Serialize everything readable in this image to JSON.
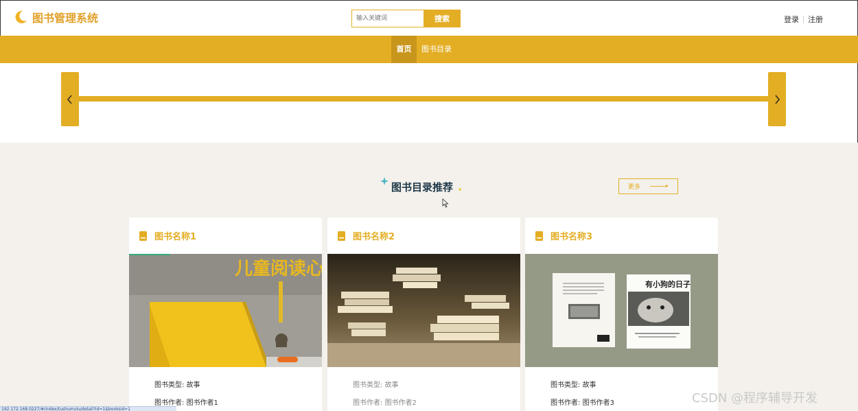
{
  "header": {
    "logo_text": "图书管理系统",
    "search_placeholder": "输入关键词",
    "search_button": "搜索",
    "login": "登录",
    "register": "注册"
  },
  "nav": {
    "items": [
      {
        "label": "首页",
        "active": true
      },
      {
        "label": "图书目录",
        "active": false
      }
    ]
  },
  "section": {
    "title": "图书目录推荐",
    "more_label": "更多"
  },
  "cards": [
    {
      "title": "图书名称1",
      "type_label": "图书类型",
      "type_value": "故事",
      "author_label": "图书作者",
      "author_value": "图书作者1",
      "cover_text": "儿童阅读心理"
    },
    {
      "title": "图书名称2",
      "type_label": "图书类型",
      "type_value": "故事",
      "author_label": "图书作者",
      "author_value": "图书作者2"
    },
    {
      "title": "图书名称3",
      "type_label": "图书类型",
      "type_value": "故事",
      "author_label": "图书作者",
      "author_value": "图书作者3",
      "cover_text": "有小狗的日子"
    }
  ],
  "statusbar": {
    "url": "192.172.168.0227/#/index/tushumulu/detail?id=1&booksid=1"
  },
  "watermark": "CSDN @程序辅导开发",
  "colors": {
    "accent": "#e3ae24",
    "nav_active": "#c9961c",
    "page_bg": "#f4f1ec",
    "title_text": "#1f3a4a"
  }
}
